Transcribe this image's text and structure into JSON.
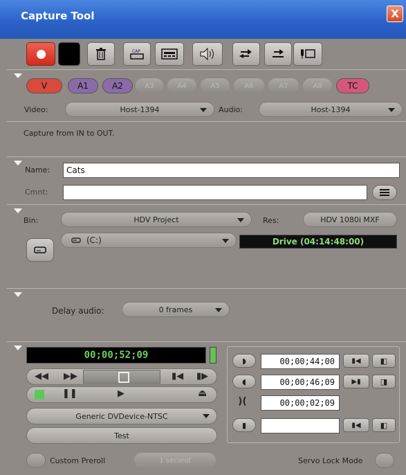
{
  "window": {
    "title": "Capture Tool",
    "close_glyph": "X"
  },
  "toolbar": {
    "icons": [
      "record-icon",
      "stop-icon",
      "trash-icon",
      "capture-mode-icon",
      "deck-icon",
      "audio-icon",
      "shuttle-left-icon",
      "shuttle-right-icon",
      "mic-icon"
    ],
    "record_color": "#e2382a"
  },
  "tracks": {
    "buttons": [
      {
        "label": "V",
        "active": true,
        "color": "#d94a3c"
      },
      {
        "label": "A1",
        "active": true,
        "color": "#8a6ba8"
      },
      {
        "label": "A2",
        "active": true,
        "color": "#8a6ba8"
      },
      {
        "label": "A3",
        "active": false
      },
      {
        "label": "A4",
        "active": false
      },
      {
        "label": "A5",
        "active": false
      },
      {
        "label": "A6",
        "active": false
      },
      {
        "label": "A7",
        "active": false
      },
      {
        "label": "A8",
        "active": false
      },
      {
        "label": "TC",
        "active": true,
        "color": "#d4587c"
      }
    ],
    "video_label": "Video:",
    "video_value": "Host-1394",
    "audio_label": "Audio:",
    "audio_value": "Host-1394"
  },
  "status": {
    "message": "Capture from IN to OUT."
  },
  "clip": {
    "name_label": "Name:",
    "name_value": "Cats",
    "comment_label": "Cmnt:",
    "comment_value": ""
  },
  "bin": {
    "bin_label": "Bin:",
    "bin_value": "HDV Project",
    "res_label": "Res:",
    "res_value": "HDV 1080i  MXF",
    "drive_value": "(C:)",
    "drive_status": "Drive (04:14:48:00)"
  },
  "delay": {
    "label": "Delay audio:",
    "value": "0 frames"
  },
  "deck": {
    "timecode": "00;00;52;09",
    "mark_in": "00;00;44;00",
    "mark_out": "00;00;46;09",
    "duration": "00;00;02;09",
    "extra": "",
    "device": "Generic DVDevice-NTSC",
    "test_label": "Test",
    "custom_preroll_label": "Custom Preroll",
    "preroll_value": "1 second",
    "servo_label": "Servo Lock Mode"
  }
}
